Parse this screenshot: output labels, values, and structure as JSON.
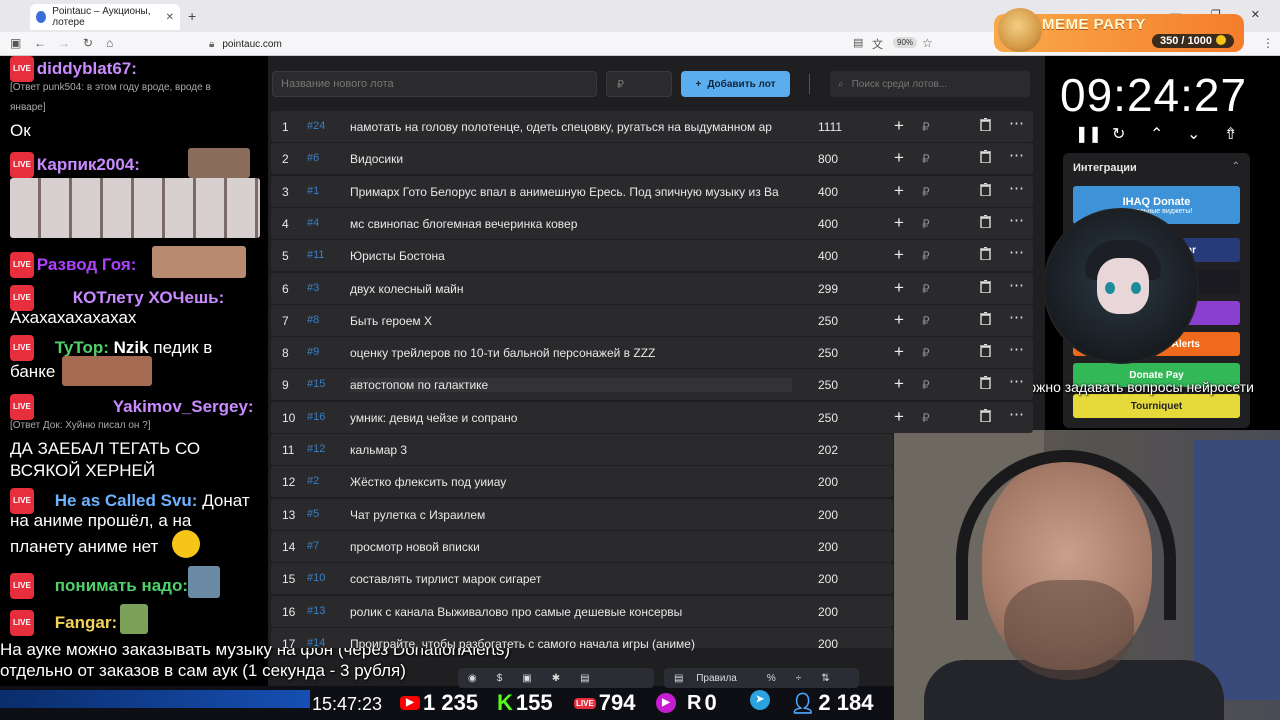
{
  "browser": {
    "tab_title": "Pointauc – Аукционы, лотере",
    "url": "pointauc.com",
    "zoom": "90%"
  },
  "meme_party": {
    "title": "MEME PARTY",
    "counter": "350 / 1000"
  },
  "chat": {
    "m1_nick": "diddyblat67:",
    "m1_reply": "[Ответ punk504: в этом году вроде, вроде в",
    "m1_reply2": "январе]",
    "m1_text": "Ок",
    "m2_nick": "Карпик2004:",
    "m3_nick": "Развод Гоя:",
    "m4_nick": "КОТлету ХОЧешь:",
    "m4_text": "Ахахахахахахах",
    "m5_nick": "TyTop:",
    "m5_text_bold": "Nzik",
    "m5_text": "педик в",
    "m5_text2": "банке",
    "m6_nick": "Yakimov_Sergey:",
    "m6_reply": "[Ответ Док: Хуйню писал он ?]",
    "m6_text": "ДА ЗАЕБАЛ ТЕГАТЬ СО",
    "m6_text2": "ВСЯКОЙ ХЕРНЕЙ",
    "m7_nick": "He as Called Svu:",
    "m7_text": "Донат",
    "m7_text2": "на аниме прошёл, а на",
    "m7_text3": "планету аниме нет",
    "m8_nick": "понимать надо:",
    "m9_nick": "Fangar:",
    "live": "LIVE"
  },
  "app": {
    "lot_placeholder": "Название нового лота",
    "price_placeholder": "₽",
    "add_button": "Добавить лот",
    "search_placeholder": "Поиск среди лотов...",
    "lots": [
      {
        "n": "1",
        "id": "#24",
        "name": "намотать на голову полотенце, одеть спецовку, ругаться на выдуманном ар",
        "amount": "1111"
      },
      {
        "n": "2",
        "id": "#6",
        "name": "Видосики",
        "amount": "800"
      },
      {
        "n": "3",
        "id": "#1",
        "name": "Примарх Гото Белорус впал в анимешную Ересь. Под эпичную музыку из Ва",
        "amount": "400"
      },
      {
        "n": "4",
        "id": "#4",
        "name": "мс свинопас блогемная вечеринка ковер",
        "amount": "400"
      },
      {
        "n": "5",
        "id": "#11",
        "name": "Юристы Бостона",
        "amount": "400"
      },
      {
        "n": "6",
        "id": "#3",
        "name": "двух колесный майн",
        "amount": "299"
      },
      {
        "n": "7",
        "id": "#8",
        "name": "Быть героем Х",
        "amount": "250"
      },
      {
        "n": "8",
        "id": "#9",
        "name": "оценку трейлеров по 10-ти бальной персонажей в ZZZ",
        "amount": "250"
      },
      {
        "n": "9",
        "id": "#15",
        "name": "автостопом по галактике",
        "amount": "250"
      },
      {
        "n": "10",
        "id": "#16",
        "name": "умник: девид чейзе и сопрано",
        "amount": "250"
      },
      {
        "n": "11",
        "id": "#12",
        "name": "кальмар 3",
        "amount": "202"
      },
      {
        "n": "12",
        "id": "#2",
        "name": "Жёстко флексить под уииау",
        "amount": "200"
      },
      {
        "n": "13",
        "id": "#5",
        "name": "Чат рулетка с Израилем",
        "amount": "200"
      },
      {
        "n": "14",
        "id": "#7",
        "name": "просмотр новой вписки",
        "amount": "200"
      },
      {
        "n": "15",
        "id": "#10",
        "name": "составлять тирлист марок сигарет",
        "amount": "200"
      },
      {
        "n": "16",
        "id": "#13",
        "name": "ролик с канала Выживалово про самые дешевые консервы",
        "amount": "200"
      },
      {
        "n": "17",
        "id": "#14",
        "name": "Проиграйте, чтобы разбогатеть с самого начала игры (аниме)",
        "amount": "200"
      }
    ]
  },
  "timer": {
    "value": "09:24:27"
  },
  "integrations": {
    "title": "Интеграции",
    "btn1": "IHAQ Donate",
    "btn1_sub": "Уникальные виджеты!",
    "btn2": "er",
    "btn5": "Alerts",
    "btn6": "Donate Pay",
    "btn7": "Tourniquet"
  },
  "overlay": {
    "donatex": "Через Donatex можно задавать вопросы нейросети",
    "music1": "На ауке можно заказывать музыку на фон (через DonationAlerts)",
    "music2": "отдельно от заказов в сам аук (1 секунда - 3 рубля)"
  },
  "bottom": {
    "clock": "15:47:23",
    "youtube": "1 235",
    "kick": "155",
    "vk": "794",
    "rutube": "0",
    "viewers": "2 184",
    "rules": "Правила"
  }
}
